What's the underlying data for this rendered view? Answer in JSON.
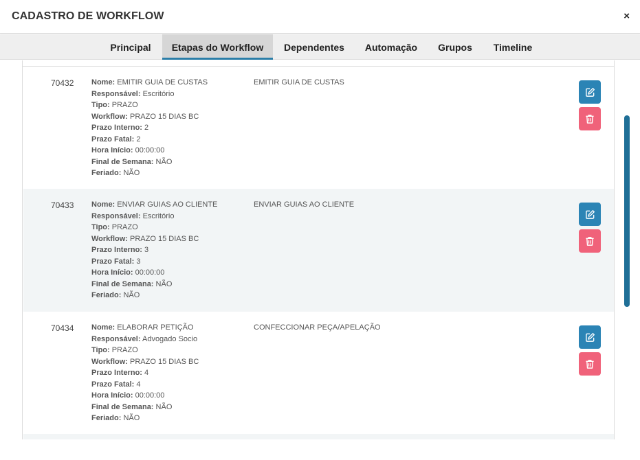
{
  "header": {
    "title": "CADASTRO DE WORKFLOW",
    "close_label": "×"
  },
  "tabs": [
    {
      "label": "Principal",
      "active": false
    },
    {
      "label": "Etapas do Workflow",
      "active": true
    },
    {
      "label": "Dependentes",
      "active": false
    },
    {
      "label": "Automação",
      "active": false
    },
    {
      "label": "Grupos",
      "active": false
    },
    {
      "label": "Timeline",
      "active": false
    }
  ],
  "field_labels": {
    "nome": "Nome:",
    "responsavel": "Responsável:",
    "tipo": "Tipo:",
    "workflow": "Workflow:",
    "prazo_interno": "Prazo Interno:",
    "prazo_fatal": "Prazo Fatal:",
    "hora_inicio": "Hora Início:",
    "final_semana": "Final de Semana:",
    "feriado": "Feriado:"
  },
  "steps": [
    {
      "id": "70432",
      "nome": "EMITIR GUIA DE CUSTAS",
      "responsavel": "Escritório",
      "tipo": "PRAZO",
      "workflow": "PRAZO 15 DIAS BC",
      "prazo_interno": "2",
      "prazo_fatal": "2",
      "hora_inicio": "00:00:00",
      "final_semana": "NÃO",
      "feriado": "NÃO",
      "descricao": "EMITIR GUIA DE CUSTAS"
    },
    {
      "id": "70433",
      "nome": "ENVIAR GUIAS AO CLIENTE",
      "responsavel": "Escritório",
      "tipo": "PRAZO",
      "workflow": "PRAZO 15 DIAS BC",
      "prazo_interno": "3",
      "prazo_fatal": "3",
      "hora_inicio": "00:00:00",
      "final_semana": "NÃO",
      "feriado": "NÃO",
      "descricao": "ENVIAR GUIAS AO CLIENTE"
    },
    {
      "id": "70434",
      "nome": "ELABORAR PETIÇÃO",
      "responsavel": "Advogado Socio",
      "tipo": "PRAZO",
      "workflow": "PRAZO 15 DIAS BC",
      "prazo_interno": "4",
      "prazo_fatal": "4",
      "hora_inicio": "00:00:00",
      "final_semana": "NÃO",
      "feriado": "NÃO",
      "descricao": "CONFECCIONAR PEÇA/APELAÇÃO"
    }
  ],
  "icons": {
    "edit": "edit-icon",
    "delete": "trash-icon"
  },
  "colors": {
    "edit_button": "#2b84b5",
    "delete_button": "#f0627a",
    "active_tab_underline": "#2b7ea8",
    "scrollbar": "#1f6f97"
  }
}
